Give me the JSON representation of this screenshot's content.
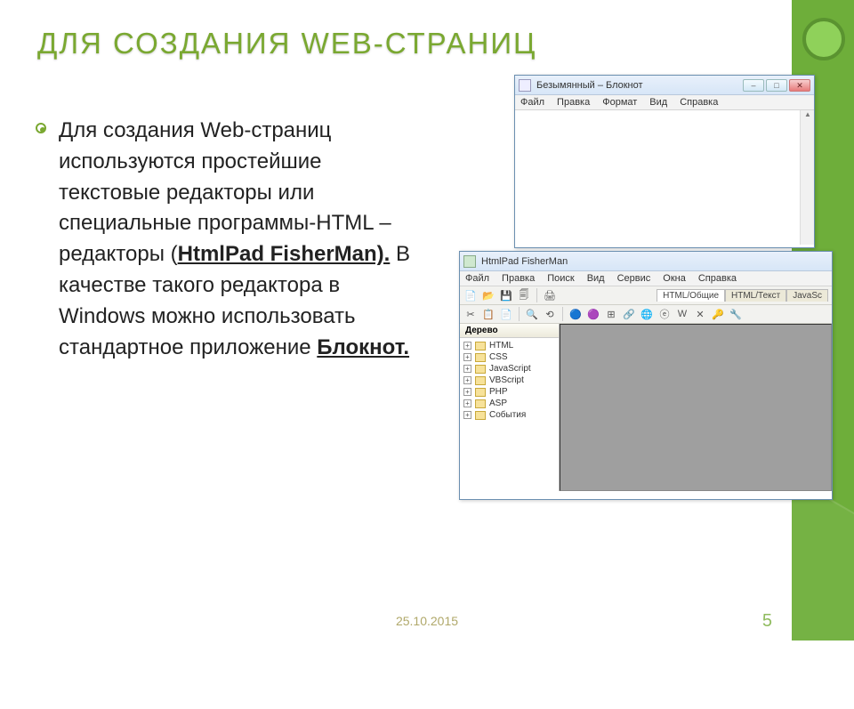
{
  "slide": {
    "title": "Для создания web-страниц",
    "body_part1": "Для создания Web-страниц используются простейшие текстовые редакторы или специальные программы-HTML – редакторы (",
    "body_bold_u1": "HtmlPad FisherMan).",
    "body_part2": " В качестве такого редактора в Windows можно использовать стандартное приложение ",
    "body_bold_u2": "Блокнот.",
    "date": "25.10.2015",
    "page": "5"
  },
  "notepad": {
    "title": "Безымянный – Блокнот",
    "menu": [
      "Файл",
      "Правка",
      "Формат",
      "Вид",
      "Справка"
    ],
    "buttons": {
      "min": "–",
      "max": "□",
      "close": "✕"
    }
  },
  "htmlpad": {
    "title": "HtmlPad FisherMan",
    "menu": [
      "Файл",
      "Правка",
      "Поиск",
      "Вид",
      "Сервис",
      "Окна",
      "Справка"
    ],
    "toolbar1_icons": [
      "📄",
      "📂",
      "💾",
      "🗐",
      "🖨"
    ],
    "tabs": [
      "HTML/Общие",
      "HTML/Текст",
      "JavaSc"
    ],
    "toolbar2_icons": [
      "✂",
      "📋",
      "📄",
      "",
      "🔍",
      "⟲",
      "",
      "🔵",
      "🟣",
      "⊞",
      "🔗",
      "🌐",
      "ⓔ",
      "W",
      "✕",
      "🔑",
      "🔧"
    ],
    "tree_header": "Дерево",
    "tree": [
      "HTML",
      "CSS",
      "JavaScript",
      "VBScript",
      "PHP",
      "ASP",
      "События"
    ]
  }
}
